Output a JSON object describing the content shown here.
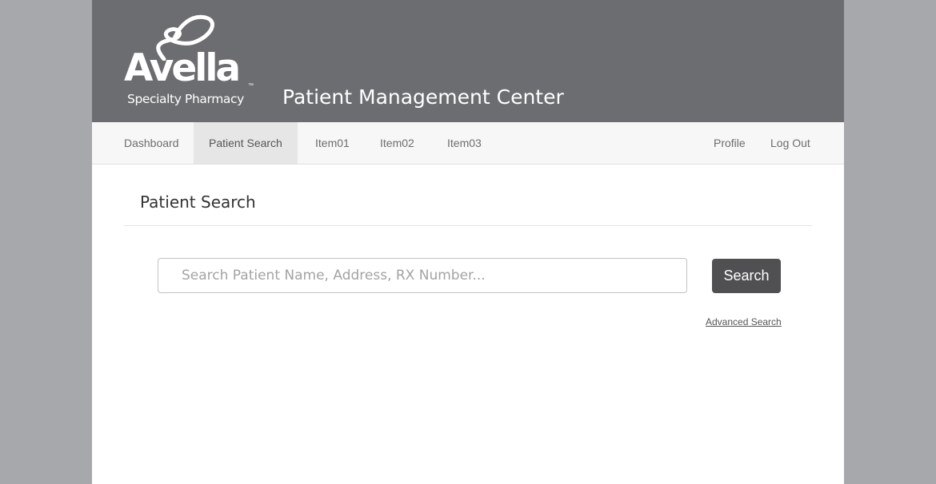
{
  "brand": {
    "logo_word": "Avella",
    "logo_trademark": "™",
    "logo_subtitle": "Specialty Pharmacy",
    "app_title": "Patient Management Center",
    "header_color": "#6c6d71"
  },
  "nav": {
    "items": [
      {
        "label": "Dashboard"
      },
      {
        "label": "Patient Search",
        "active": true
      },
      {
        "label": "Item01"
      },
      {
        "label": "Item02"
      },
      {
        "label": "Item03"
      }
    ],
    "right_items": [
      {
        "label": "Profile"
      },
      {
        "label": "Log Out"
      }
    ]
  },
  "main": {
    "section_title": "Patient Search",
    "search": {
      "placeholder": "Search Patient Name, Address, RX Number...",
      "value": "",
      "button_label": "Search"
    },
    "advanced_link": "Advanced Search"
  }
}
